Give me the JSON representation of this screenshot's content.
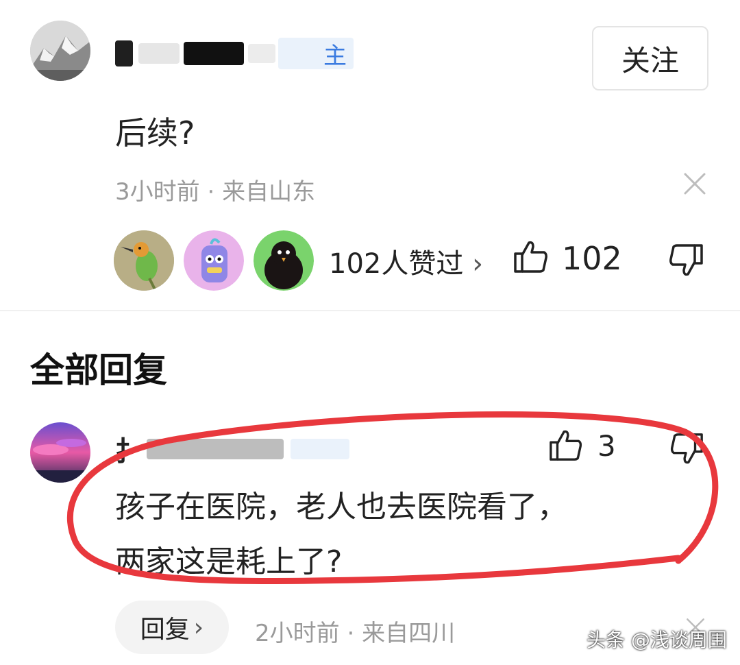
{
  "comment": {
    "author_badge": "主",
    "follow_label": "关注",
    "text": "后续?",
    "time": "3小时前",
    "separator": "·",
    "location": "来自山东",
    "close_icon": "close-icon",
    "liked_summary": "102人赞过",
    "liked_chevron": "›",
    "like_count": "102",
    "like_icon": "thumbs-up-icon",
    "dislike_icon": "thumbs-down-icon"
  },
  "section": {
    "title": "全部回复"
  },
  "reply": {
    "author_fragment": "扌",
    "like_count": "3",
    "line1": "孩子在医院，老人也去医院看了，",
    "line2": "两家这是耗上了?",
    "reply_label": "回复",
    "reply_chevron": "›",
    "time": "2小时前",
    "separator": "·",
    "location": "来自四川"
  },
  "watermark": {
    "text": "头条 @浅谈周围"
  },
  "colors": {
    "annotation_red": "#e8383d",
    "meta_gray": "#9a9a9a",
    "badge_blue": "#3a7be0"
  }
}
